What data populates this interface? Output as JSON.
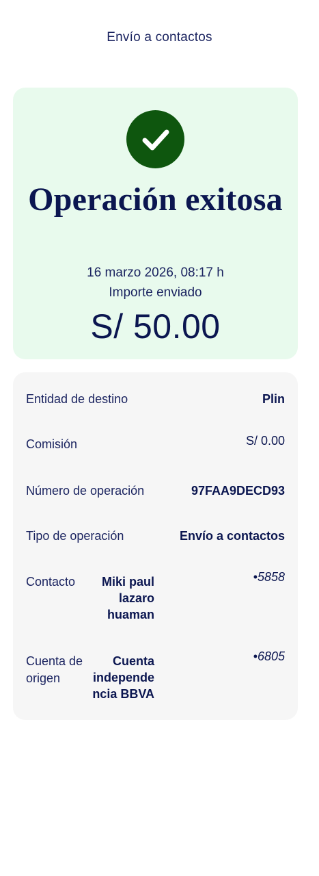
{
  "header": {
    "title": "Envío a contactos"
  },
  "success": {
    "icon": "check-icon",
    "title": "Operación exitosa",
    "date": "16 marzo 2026, 08:17 h",
    "amount_label": "Importe enviado",
    "amount": "S/ 50.00",
    "accent_color": "#0e560e",
    "card_color": "#e8faed"
  },
  "details": {
    "entity": {
      "label": "Entidad de destino",
      "value": "Plin"
    },
    "commission": {
      "label": "Comisión",
      "value": "S/ 0.00"
    },
    "operation_number": {
      "label": "Número de operación",
      "value": "97FAA9DECD93"
    },
    "operation_type": {
      "label": "Tipo de operación",
      "value": "Envío a contactos"
    },
    "contact": {
      "label": "Contacto",
      "name_lines": [
        "Miki paul",
        "lazaro",
        "huaman"
      ],
      "suffix": "•5858"
    },
    "origin_account": {
      "label_lines": [
        "Cuenta de",
        "origen"
      ],
      "name_lines": [
        "Cuenta",
        "independe",
        "ncia BBVA"
      ],
      "suffix": "•6805"
    }
  }
}
